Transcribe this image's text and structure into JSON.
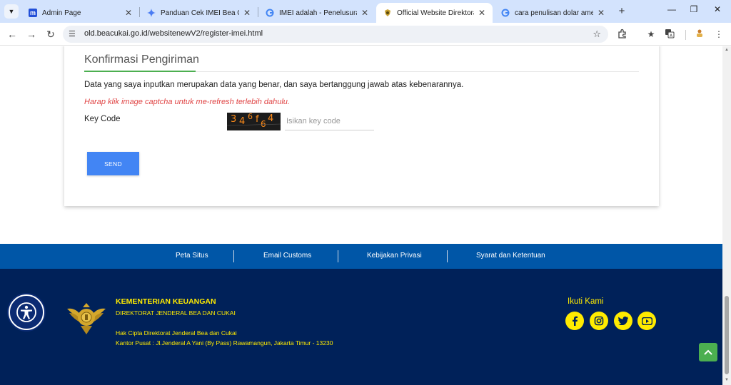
{
  "browser": {
    "tabs": [
      {
        "title": "Admin Page",
        "favicon": "m-icon",
        "active": false
      },
      {
        "title": "Panduan Cek IMEI Bea Cukai",
        "favicon": "gemini-icon",
        "active": false
      },
      {
        "title": "IMEI adalah - Penelusuran G",
        "favicon": "google-icon",
        "active": false
      },
      {
        "title": "Official Website Direktorat J",
        "favicon": "beacukai-icon",
        "active": true
      },
      {
        "title": "cara penulisan dolar amerika",
        "favicon": "google-icon",
        "active": false
      }
    ],
    "url": "old.beacukai.go.id/websitenewV2/register-imei.html"
  },
  "form": {
    "title": "Konfirmasi Pengiriman",
    "statement": "Data yang saya inputkan merupakan data yang benar, dan saya bertanggung jawab atas kebenarannya.",
    "captcha_hint": "Harap klik image captcha untuk me-refresh terlebih dahulu.",
    "keycode_label": "Key Code",
    "captcha_text": "346f64",
    "keycode_placeholder": "Isikan key code",
    "keycode_value": "",
    "send_label": "SEND"
  },
  "footer": {
    "links": [
      "Peta Situs",
      "Email Customs",
      "Kebijakan Privasi",
      "Syarat dan Ketentuan"
    ],
    "org_name": "KEMENTERIAN KEUANGAN",
    "org_sub": "DIREKTORAT JENDERAL BEA DAN CUKAI",
    "copyright": "Hak Cipta Direktorat Jenderal Bea dan Cukai",
    "address": "Kantor Pusat : Jl.Jenderal A Yani (By Pass) Rawamangun, Jakarta Timur - 13230",
    "follow_label": "Ikuti Kami",
    "social": [
      "facebook-icon",
      "instagram-icon",
      "twitter-icon",
      "youtube-icon"
    ]
  },
  "colors": {
    "tabstrip": "#d3e3fd",
    "link_bar": "#0056a7",
    "footer_bg": "#002159",
    "footer_text": "#ffeb00",
    "send_button": "#4285f4",
    "warning_text": "#e04545",
    "accent_green": "#4caf50"
  }
}
